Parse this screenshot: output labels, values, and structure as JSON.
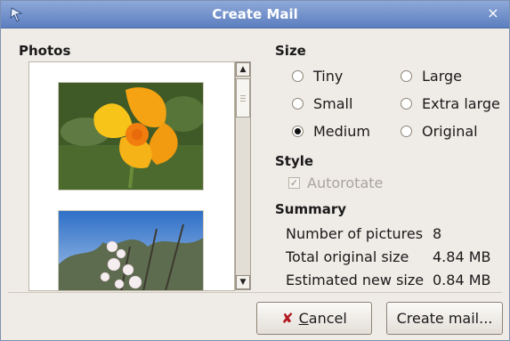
{
  "window": {
    "title": "Create Mail",
    "close_icon": "×"
  },
  "photos": {
    "heading": "Photos",
    "items": [
      {
        "name": "flower-photo"
      },
      {
        "name": "blossom-photo"
      }
    ]
  },
  "size": {
    "heading": "Size",
    "options": [
      "Tiny",
      "Large",
      "Small",
      "Extra large",
      "Medium",
      "Original"
    ],
    "selected": "Medium"
  },
  "style": {
    "heading": "Style",
    "autorotate_label": "Autorotate",
    "autorotate_checked": true,
    "autorotate_enabled": false
  },
  "summary": {
    "heading": "Summary",
    "number_label": "Number of pictures",
    "number_value": "8",
    "original_label": "Total original size",
    "original_value": "4.84 MB",
    "estimated_label": "Estimated new size",
    "estimated_value": "0.84 MB"
  },
  "buttons": {
    "cancel_mnemonic": "C",
    "cancel_rest": "ancel",
    "create": "Create mail..."
  },
  "colors": {
    "titlebar": "#5c7fc0",
    "cancel_icon": "#b1171f"
  }
}
